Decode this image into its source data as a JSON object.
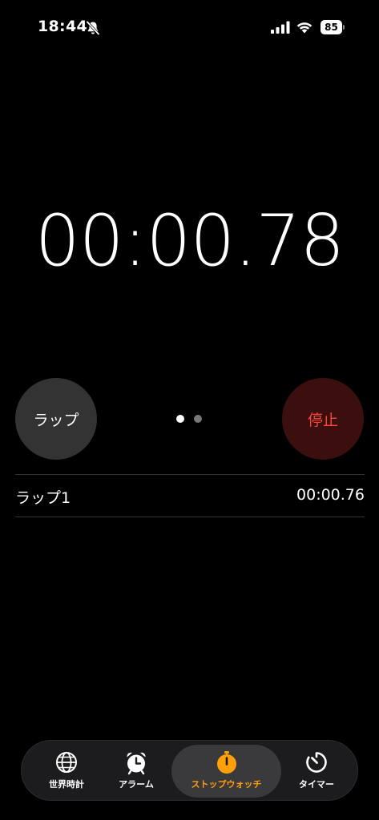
{
  "status_bar": {
    "time": "18:44",
    "battery": "85"
  },
  "stopwatch": {
    "elapsed": "00:00.78"
  },
  "controls": {
    "lap_label": "ラップ",
    "stop_label": "停止"
  },
  "laps": [
    {
      "label": "ラップ1",
      "time": "00:00.76"
    }
  ],
  "tabs": {
    "world_clock": "世界時計",
    "alarm": "アラーム",
    "stopwatch": "ストップウォッチ",
    "timer": "タイマー",
    "active": "stopwatch"
  },
  "colors": {
    "accent": "#ff9f0a",
    "stop_text": "#ff453a",
    "stop_bg": "#3a0f0d",
    "lap_bg": "#333333"
  },
  "page_dots": {
    "count": 2,
    "active": 1
  }
}
